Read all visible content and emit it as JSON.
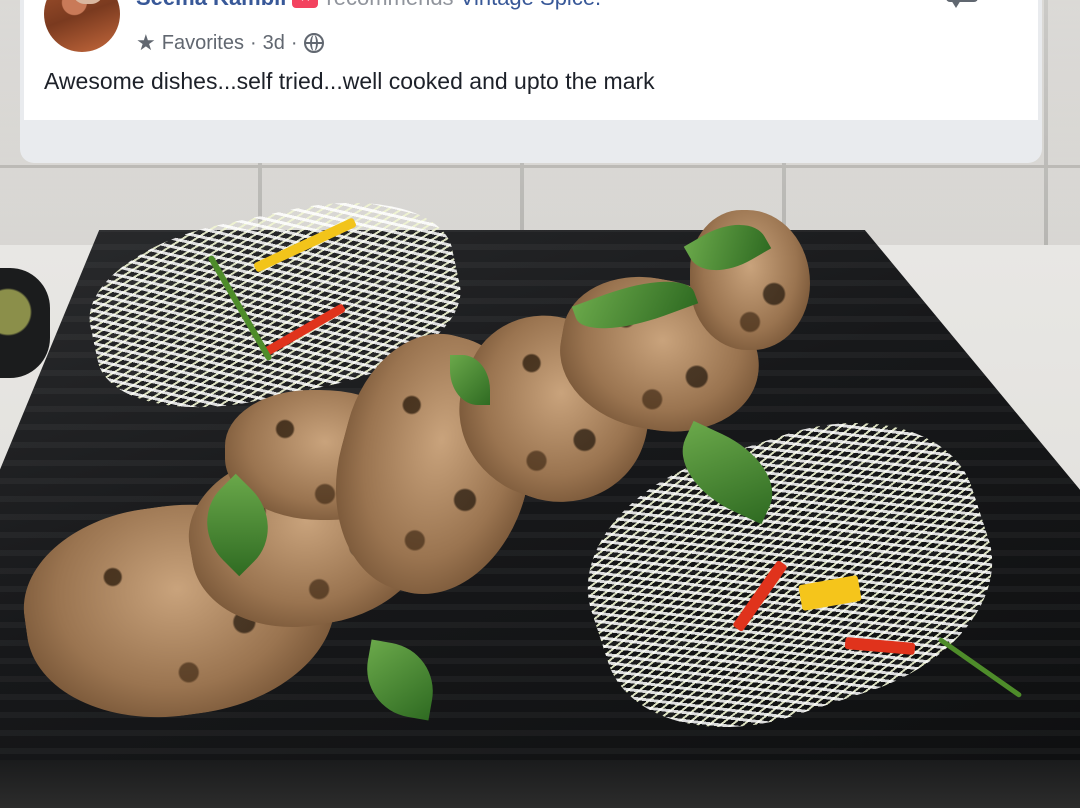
{
  "post": {
    "author": "Seema Kambli",
    "recommendation": "recommends",
    "page_name": "Vintage Spice.",
    "audience": "Favorites",
    "separator": "·",
    "time_ago": "3d",
    "body": "Awesome dishes...self tried...well cooked and upto the mark"
  },
  "icons": {
    "audience": "star-icon",
    "privacy": "globe-icon",
    "badge": "recommend-icon",
    "comment": "comment-icon",
    "more": "more-options-icon"
  },
  "colors": {
    "link": "#385898",
    "badge": "#f3425f",
    "meta_text": "#616770",
    "body_text": "#1d2129"
  }
}
